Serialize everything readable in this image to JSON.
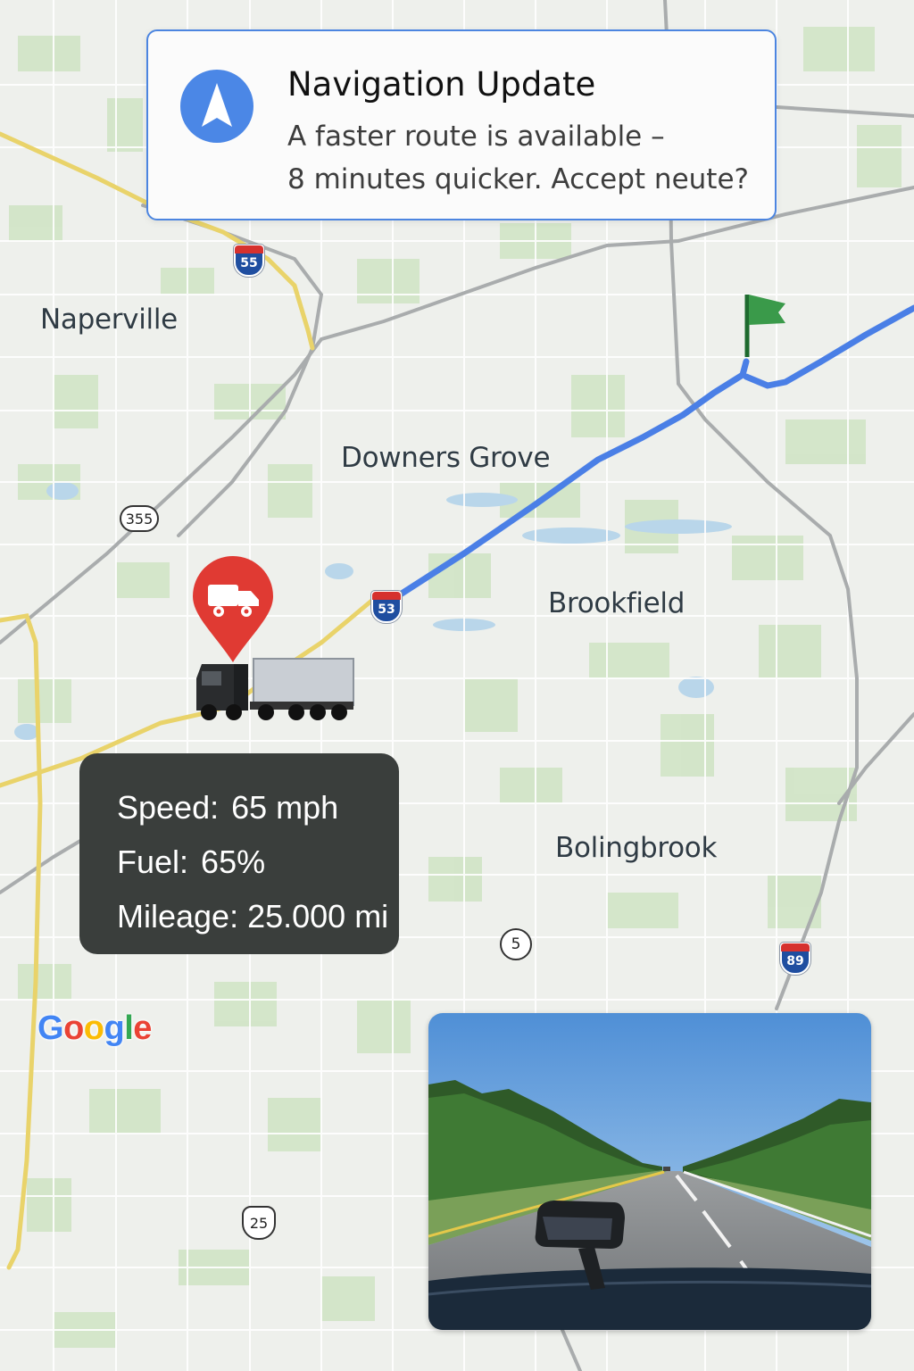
{
  "notification": {
    "title": "Navigation Update",
    "body_line1": "A faster route is available –",
    "body_line2": "8 minutes quicker. Accept neute?",
    "icon": "navigation-arrow-icon"
  },
  "cities": {
    "naperville": "Naperville",
    "downers_grove": "Downers Grove",
    "brookfield": "Brookfield",
    "bolingbrook": "Bolingbrook"
  },
  "shields": {
    "i55": "55",
    "i53": "53",
    "i89": "89",
    "r355": "355",
    "r5": "5",
    "us25": "25"
  },
  "vehicle_stats": {
    "speed_label": "Speed:",
    "speed_value": "65 mph",
    "fuel_label": "Fuel:",
    "fuel_value": "65%",
    "mileage_label": "Mileage:",
    "mileage_value": "25.000 mi"
  },
  "map_attribution": "Google",
  "colors": {
    "route": "#4a7fe6",
    "notification_border": "#4c85e0",
    "pin": "#e03a33",
    "destination_flag": "#3a9a4a",
    "stats_bg": "#3a3e3c"
  },
  "icons": {
    "truck_pin": "truck-pin-icon",
    "truck": "semi-truck-icon",
    "destination": "destination-flag-icon"
  },
  "camera_view": "dashcam-highway-view"
}
